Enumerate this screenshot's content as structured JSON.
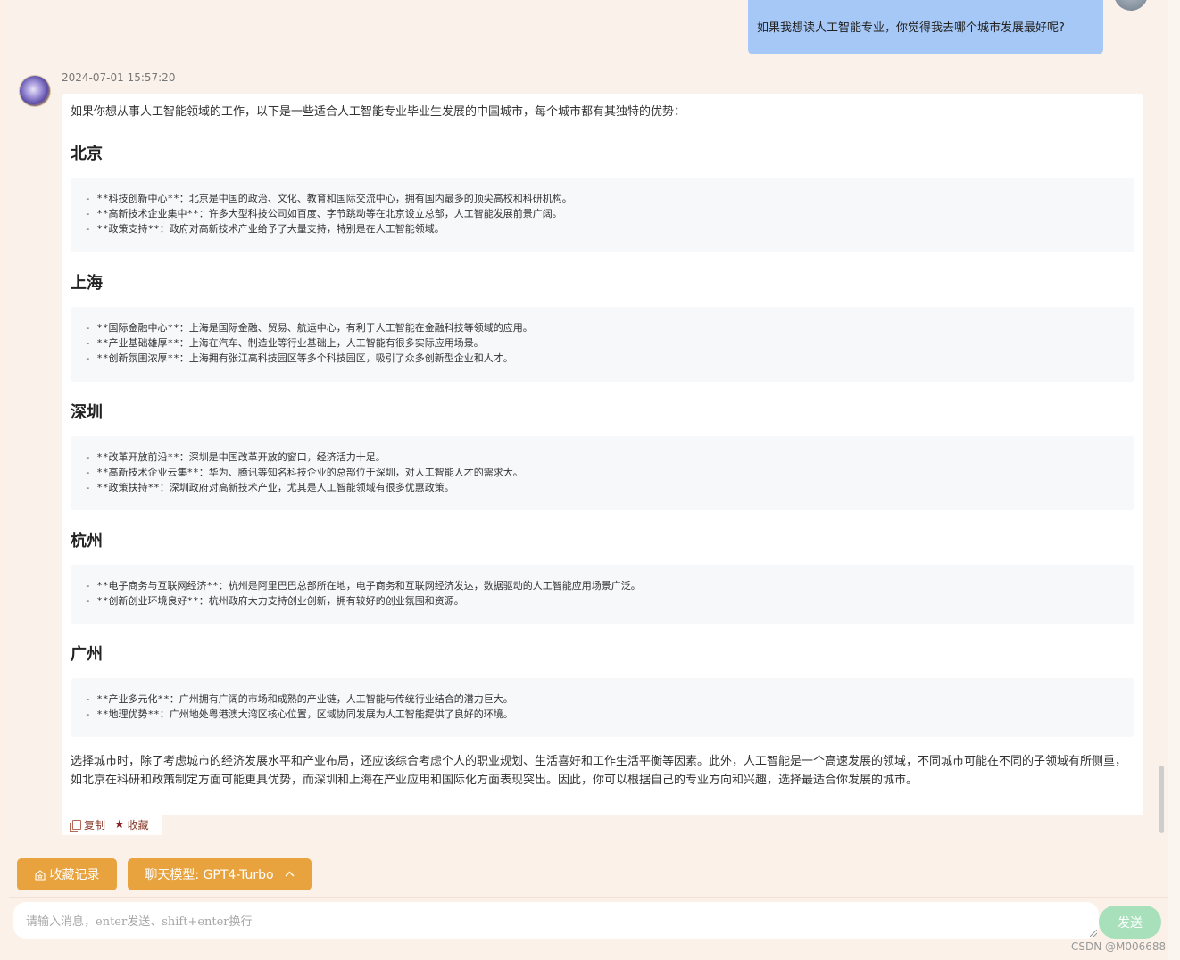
{
  "user_message": {
    "text": "如果我想读人工智能专业，你觉得我去哪个城市发展最好呢?"
  },
  "bot_message": {
    "timestamp": "2024-07-01 15:57:20",
    "intro": "如果你想从事人工智能领域的工作，以下是一些适合人工智能专业毕业生发展的中国城市，每个城市都有其独特的优势：",
    "cities": [
      {
        "name": "北京",
        "lines": [
          "- **科技创新中心**：北京是中国的政治、文化、教育和国际交流中心，拥有国内最多的顶尖高校和科研机构。",
          "- **高新技术企业集中**：许多大型科技公司如百度、字节跳动等在北京设立总部，人工智能发展前景广阔。",
          "- **政策支持**：政府对高新技术产业给予了大量支持，特别是在人工智能领域。"
        ]
      },
      {
        "name": "上海",
        "lines": [
          "- **国际金融中心**：上海是国际金融、贸易、航运中心，有利于人工智能在金融科技等领域的应用。",
          "- **产业基础雄厚**：上海在汽车、制造业等行业基础上，人工智能有很多实际应用场景。",
          "- **创新氛围浓厚**：上海拥有张江高科技园区等多个科技园区，吸引了众多创新型企业和人才。"
        ]
      },
      {
        "name": "深圳",
        "lines": [
          "- **改革开放前沿**：深圳是中国改革开放的窗口，经济活力十足。",
          "- **高新技术企业云集**：华为、腾讯等知名科技企业的总部位于深圳，对人工智能人才的需求大。",
          "- **政策扶持**：深圳政府对高新技术产业，尤其是人工智能领域有很多优惠政策。"
        ]
      },
      {
        "name": "杭州",
        "lines": [
          "- **电子商务与互联网经济**：杭州是阿里巴巴总部所在地，电子商务和互联网经济发达，数据驱动的人工智能应用场景广泛。",
          "- **创新创业环境良好**：杭州政府大力支持创业创新，拥有较好的创业氛围和资源。"
        ]
      },
      {
        "name": "广州",
        "lines": [
          "- **产业多元化**：广州拥有广阔的市场和成熟的产业链，人工智能与传统行业结合的潜力巨大。",
          "- **地理优势**：广州地处粤港澳大湾区核心位置，区域协同发展为人工智能提供了良好的环境。"
        ]
      }
    ],
    "summary": "选择城市时，除了考虑城市的经济发展水平和产业布局，还应该综合考虑个人的职业规划、生活喜好和工作生活平衡等因素。此外，人工智能是一个高速发展的领域，不同城市可能在不同的子领域有所侧重，如北京在科研和政策制定方面可能更具优势，而深圳和上海在产业应用和国际化方面表现突出。因此，你可以根据自己的专业方向和兴趣，选择最适合你发展的城市。",
    "actions": {
      "copy_label": "复制",
      "favorite_label": "收藏"
    }
  },
  "toolbar": {
    "favorites_label": "收藏记录",
    "model_label": "聊天模型: GPT4-Turbo"
  },
  "composer": {
    "placeholder": "请输入消息，enter发送、shift+enter换行",
    "send_label": "发送"
  },
  "watermark": "CSDN @M006688",
  "colors": {
    "accent": "#e8a33e",
    "user_bubble": "#a6c8f7",
    "send_button": "#a9e0bc",
    "background": "#fbf1e8"
  }
}
